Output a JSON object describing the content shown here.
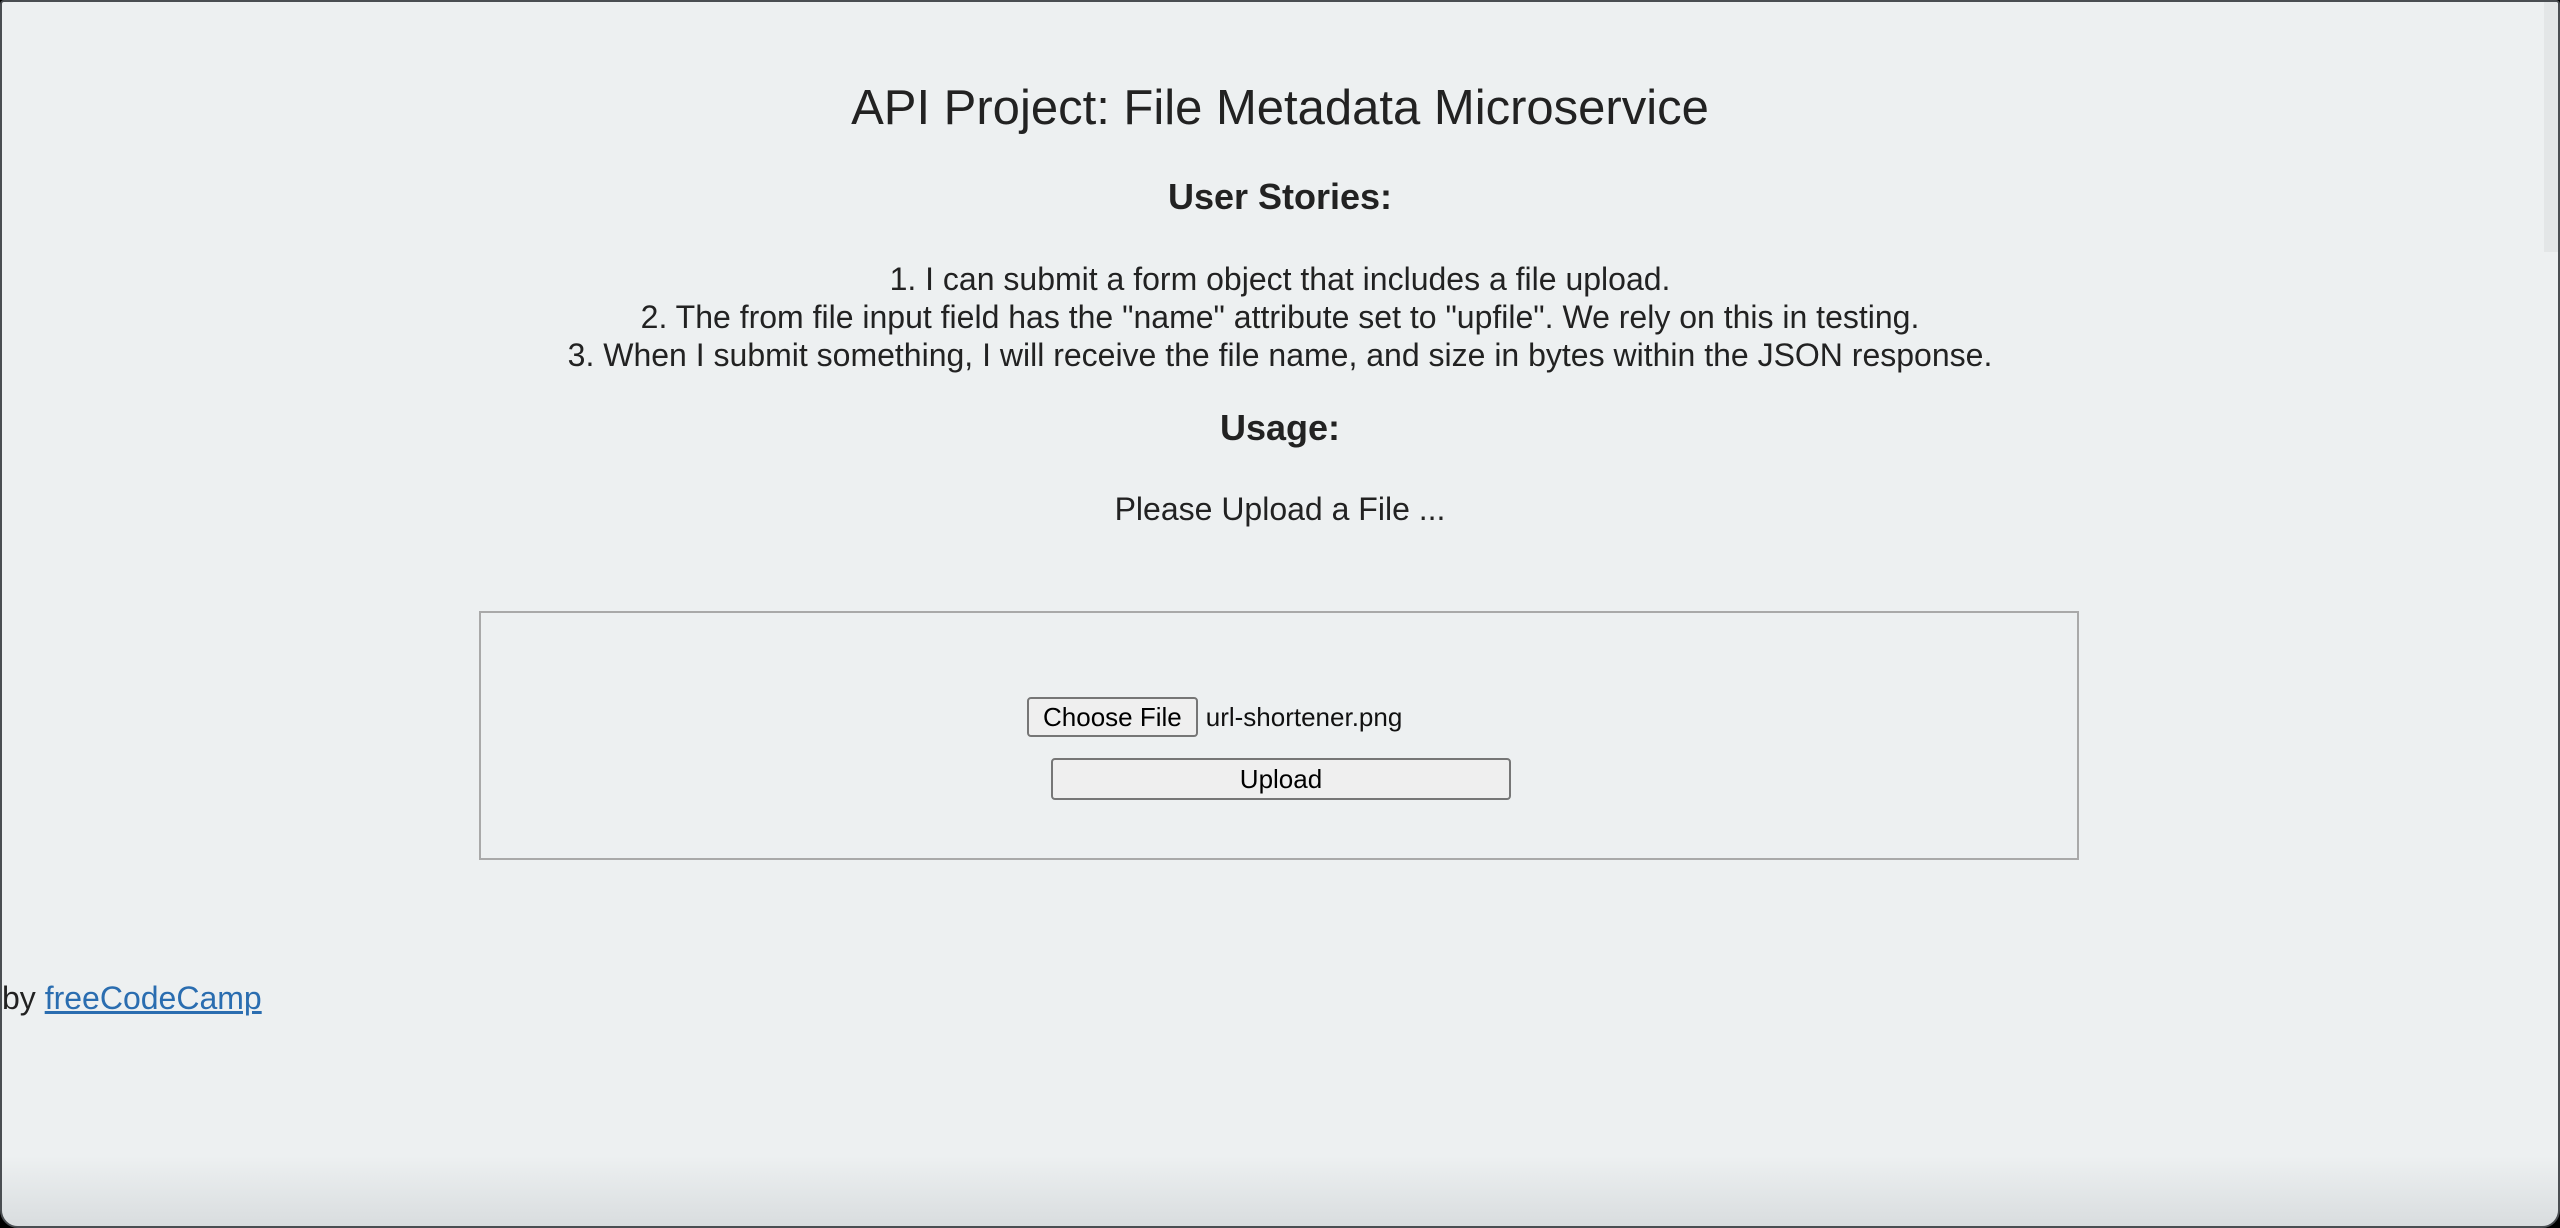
{
  "page": {
    "title": "API Project: File Metadata Microservice"
  },
  "stories": {
    "heading": "User Stories:",
    "items": [
      "1. I can submit a form object that includes a file upload.",
      "2. The from file input field has the \"name\" attribute set to \"upfile\". We rely on this in testing.",
      "3. When I submit something, I will receive the file name, and size in bytes within the JSON response."
    ]
  },
  "usage": {
    "heading": "Usage:",
    "message": "Please Upload a File ..."
  },
  "form": {
    "choose_label": "Choose File",
    "selected_file": "url-shortener.png",
    "upload_label": "Upload"
  },
  "footer": {
    "prefix": "by ",
    "link_text": "freeCodeCamp"
  },
  "colors": {
    "background": "#edf0f1",
    "link": "#2a6db0",
    "text": "#222222"
  }
}
